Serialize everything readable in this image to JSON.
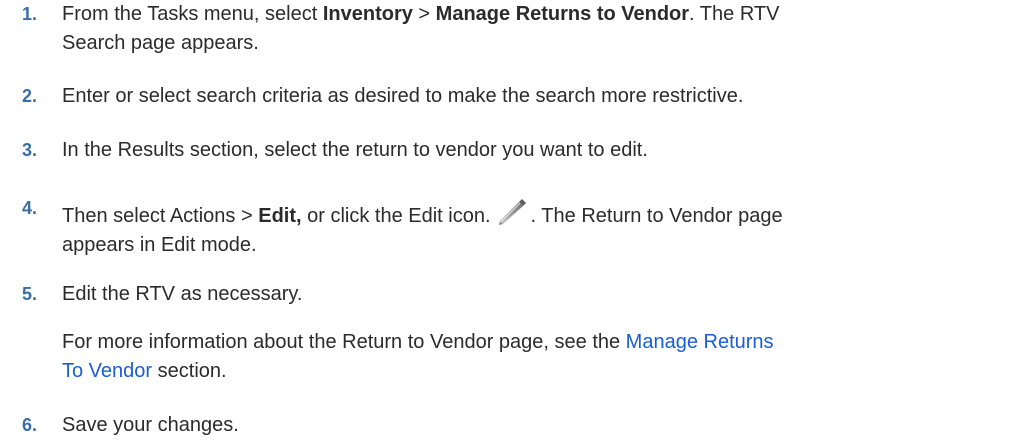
{
  "steps": [
    {
      "number": "1.",
      "parts": {
        "a": "From the Tasks menu, select ",
        "b1": "Inventory",
        "c": " > ",
        "b2": "Manage Returns to Vendor",
        "d": ". The RTV",
        "e": "Search page appears."
      }
    },
    {
      "number": "2.",
      "text": "Enter or select search criteria as desired to make the search more restrictive."
    },
    {
      "number": "3.",
      "text": "In the Results section, select the return to vendor you want to edit."
    },
    {
      "number": "4.",
      "parts": {
        "a": "Then select Actions > ",
        "b": "Edit,",
        "c": " or click the Edit icon.",
        "d": ". The Return to Vendor page",
        "e": "appears in Edit mode."
      },
      "icon": "pencil-icon"
    },
    {
      "number": "5.",
      "text": "Edit the RTV as necessary.",
      "note": {
        "prefix": "For more information about the Return to Vendor page, see the ",
        "link1": "Manage Returns",
        "link2": "To Vendor",
        "suffix": " section."
      }
    },
    {
      "number": "6.",
      "text": "Save your changes."
    }
  ],
  "colors": {
    "step_number": "#3a6ea5",
    "link": "#1a5dd8",
    "body_text": "#2b2b2b"
  }
}
